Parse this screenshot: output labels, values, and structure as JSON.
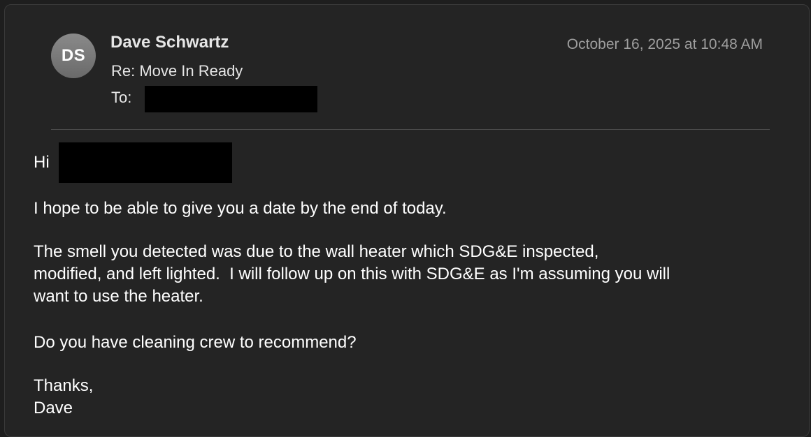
{
  "message": {
    "avatar_initials": "DS",
    "sender_name": "Dave Schwartz",
    "subject": "Re: Move In Ready",
    "to_label": "To:",
    "timestamp": "October 16, 2025 at 10:48 AM"
  },
  "body": {
    "greeting": "Hi",
    "line1": "I hope to be able to give you a date by the end of today.",
    "para2_line1": "The smell you detected was due to the wall heater which SDG&E inspected,",
    "para2_line2": "modified, and left lighted.  I will follow up on this with SDG&E as I'm assuming you will",
    "para2_line3": "want to use the heater.",
    "line3": "Do you have cleaning crew to recommend?",
    "signoff": "Thanks,",
    "signature": "Dave"
  },
  "colors": {
    "background": "#242424",
    "text": "#ffffff",
    "secondary_text": "#9e9e9e",
    "redaction": "#000000"
  }
}
